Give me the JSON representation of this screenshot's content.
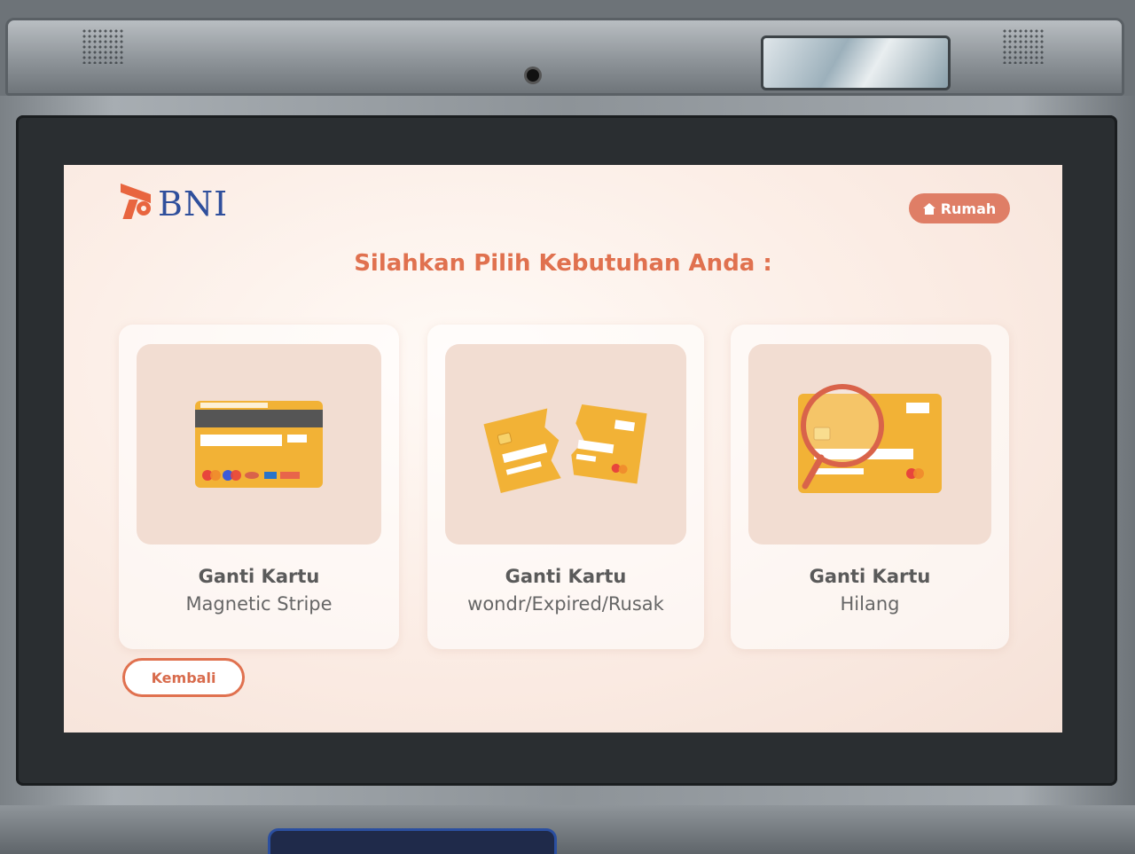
{
  "brand": {
    "name": "BNI"
  },
  "header": {
    "home_label": "Rumah"
  },
  "heading": "Silahkan Pilih Kebutuhan Anda :",
  "options": [
    {
      "title": "Ganti Kartu",
      "subtitle": "Magnetic Stripe",
      "icon": "card-back-magnetic-icon"
    },
    {
      "title": "Ganti Kartu",
      "subtitle": "wondr/Expired/Rusak",
      "icon": "broken-card-icon"
    },
    {
      "title": "Ganti Kartu",
      "subtitle": "Hilang",
      "icon": "card-magnifier-icon"
    }
  ],
  "footer": {
    "back_label": "Kembali"
  },
  "colors": {
    "accent": "#e0714f",
    "brand_blue": "#2f4f9c",
    "card_gold": "#f2b236"
  }
}
